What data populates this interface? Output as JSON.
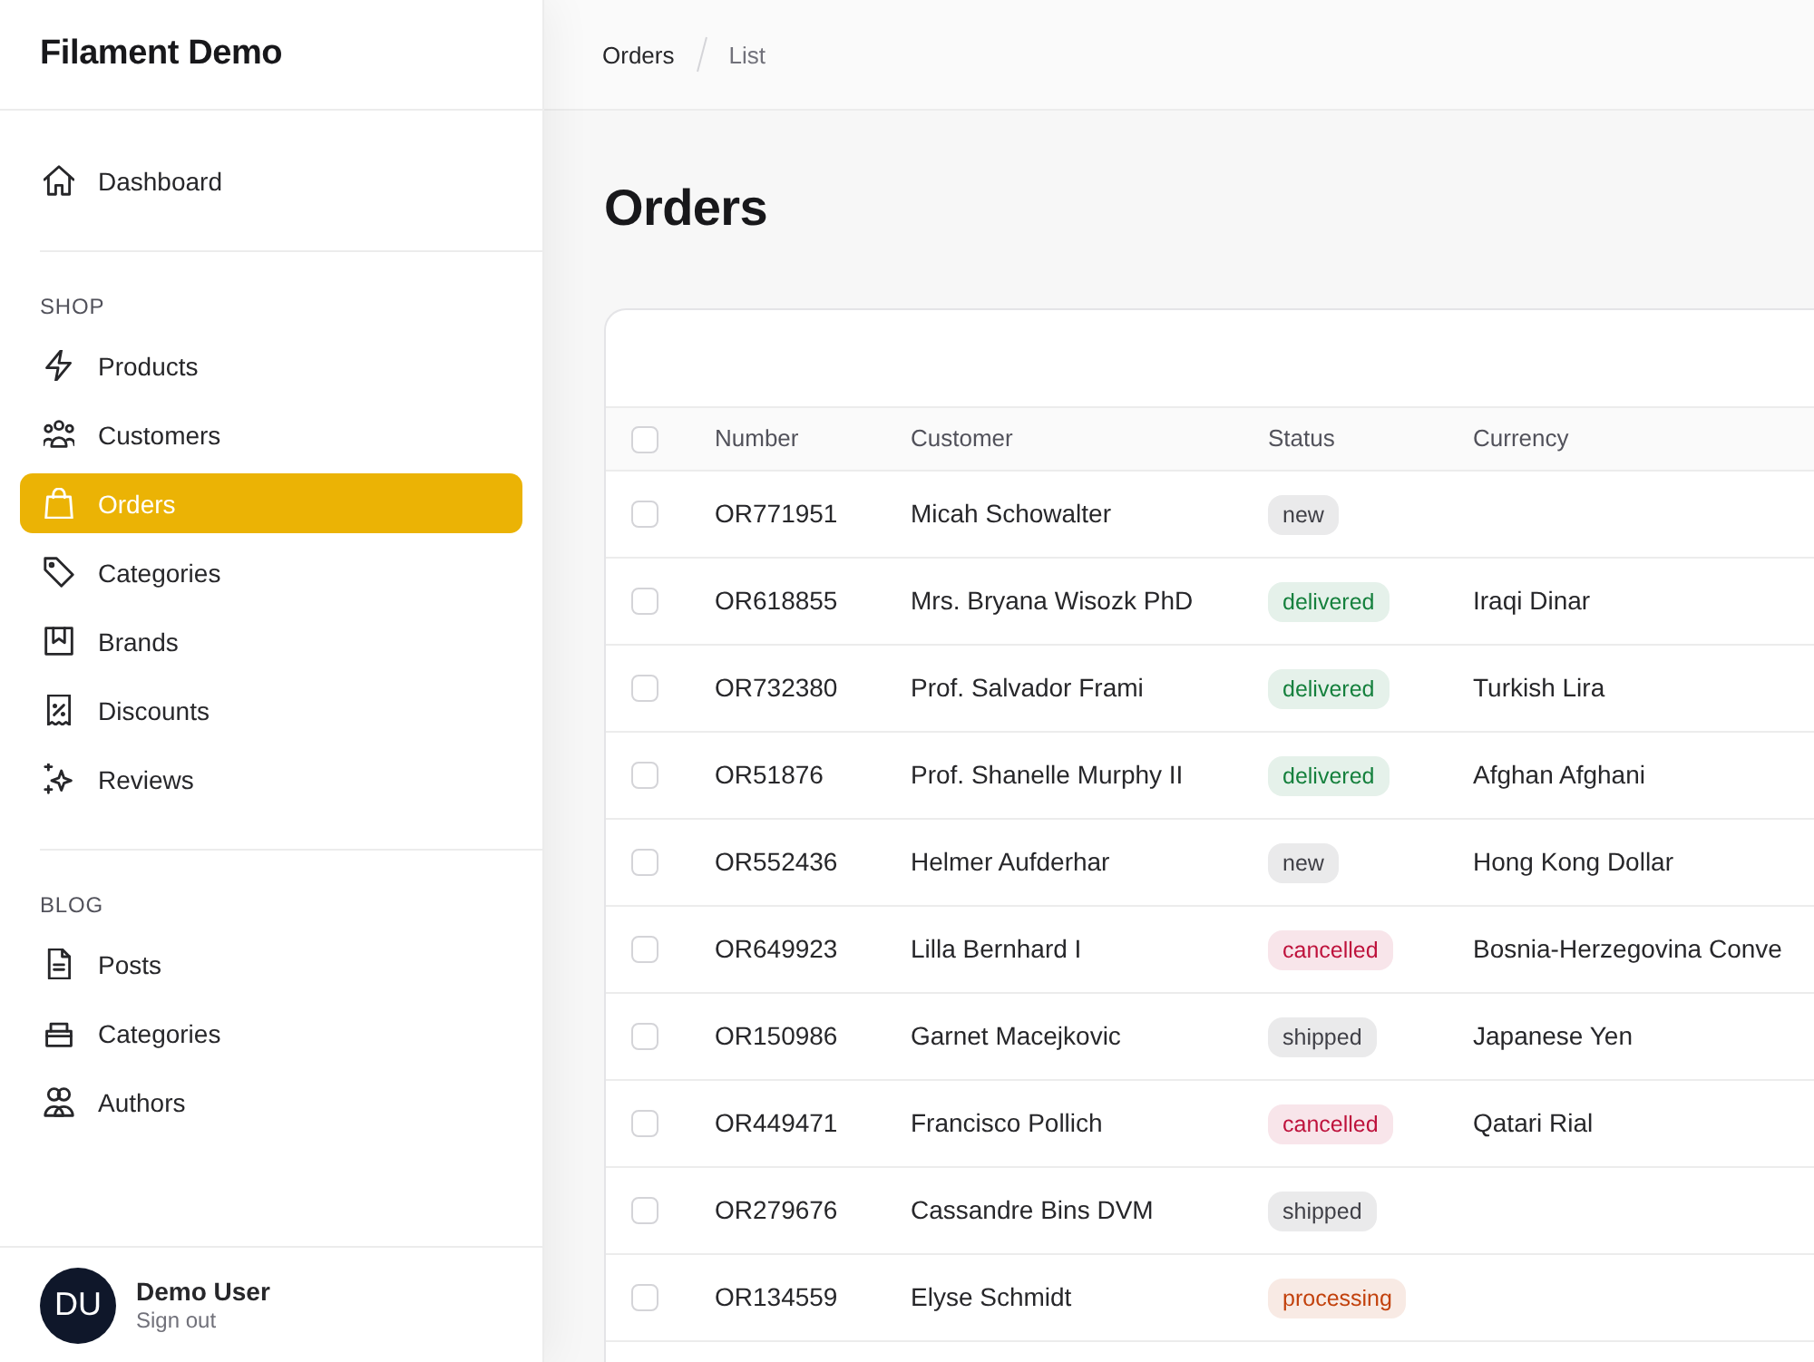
{
  "sidebar": {
    "brand": "Filament Demo",
    "groups": [
      {
        "items": [
          {
            "label": "Dashboard",
            "selected": false
          }
        ]
      },
      {
        "heading": "SHOP",
        "items": [
          {
            "label": "Products",
            "selected": false
          },
          {
            "label": "Customers",
            "selected": false
          },
          {
            "label": "Orders",
            "selected": true
          },
          {
            "label": "Categories",
            "selected": false
          },
          {
            "label": "Brands",
            "selected": false
          },
          {
            "label": "Discounts",
            "selected": false
          },
          {
            "label": "Reviews",
            "selected": false
          }
        ]
      },
      {
        "heading": "BLOG",
        "items": [
          {
            "label": "Posts",
            "selected": false
          },
          {
            "label": "Categories",
            "selected": false
          },
          {
            "label": "Authors",
            "selected": false
          }
        ]
      }
    ],
    "user": {
      "initials": "DU",
      "name": "Demo User",
      "action": "Sign out"
    }
  },
  "breadcrumbs": [
    "Orders",
    "List"
  ],
  "page": {
    "title": "Orders"
  },
  "table": {
    "select_all": {
      "checked": false
    },
    "columns": [
      "Number",
      "Customer",
      "Status",
      "Currency"
    ],
    "rows": [
      {
        "checked": false,
        "number": "OR771951",
        "customer": "Micah Schowalter",
        "status": {
          "label": "new",
          "color": "#3f3f46"
        }
      },
      {
        "checked": false,
        "number": "OR618855",
        "customer": "Mrs. Bryana Wisozk PhD",
        "status": {
          "label": "delivered",
          "color": "#15803d"
        },
        "currency": "Iraqi Dinar"
      },
      {
        "checked": false,
        "number": "OR732380",
        "customer": "Prof. Salvador Frami",
        "status": {
          "label": "delivered",
          "color": "#15803d"
        },
        "currency": "Turkish Lira"
      },
      {
        "checked": false,
        "number": "OR51876",
        "customer": "Prof. Shanelle Murphy II",
        "status": {
          "label": "delivered",
          "color": "#15803d"
        },
        "currency": "Afghan Afghani"
      },
      {
        "checked": false,
        "number": "OR552436",
        "customer": "Helmer Aufderhar",
        "status": {
          "label": "new",
          "color": "#3f3f46"
        },
        "currency": "Hong Kong Dollar"
      },
      {
        "checked": false,
        "number": "OR649923",
        "customer": "Lilla Bernhard I",
        "status": {
          "label": "cancelled",
          "color": "#be123c"
        },
        "currency": "Bosnia-Herzegovina Conve"
      },
      {
        "checked": false,
        "number": "OR150986",
        "customer": "Garnet Macejkovic",
        "status": {
          "label": "shipped",
          "color": "#3f3f46"
        },
        "currency": "Japanese Yen"
      },
      {
        "checked": false,
        "number": "OR449471",
        "customer": "Francisco Pollich",
        "status": {
          "label": "cancelled",
          "color": "#be123c"
        },
        "currency": "Qatari Rial"
      },
      {
        "checked": false,
        "number": "OR279676",
        "customer": "Cassandre Bins DVM",
        "status": {
          "label": "shipped",
          "color": "#3f3f46"
        }
      },
      {
        "checked": false,
        "number": "OR134559",
        "customer": "Elyse Schmidt",
        "status": {
          "label": "processing",
          "color": "#c2410c"
        }
      }
    ]
  }
}
